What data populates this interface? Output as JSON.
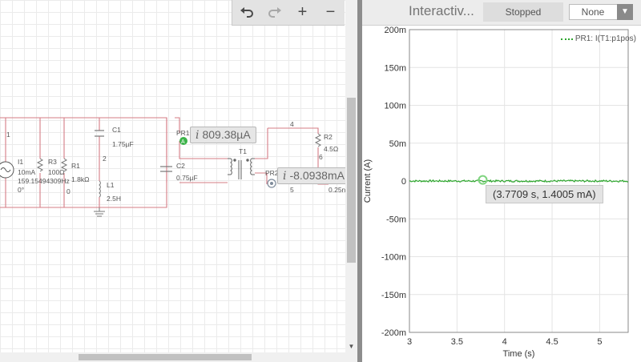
{
  "toolbar": {
    "undo_icon": "undo-icon",
    "redo_icon": "redo-icon",
    "zoom_in_label": "+",
    "zoom_out_label": "−"
  },
  "schematic": {
    "nodes": [
      "1",
      "2",
      "4",
      "5",
      "6",
      "0"
    ],
    "components": {
      "I1": {
        "name": "I1",
        "amp": "10mA",
        "freq": "159.15494309Hz",
        "phase": "0°"
      },
      "R3": {
        "name": "R3",
        "value": "100Ω"
      },
      "R1": {
        "name": "R1",
        "value": "1.8kΩ"
      },
      "C1": {
        "name": "C1",
        "value": "1.75µF"
      },
      "L1": {
        "name": "L1",
        "value": "2.5H"
      },
      "C2": {
        "name": "C2",
        "value": "0.75µF"
      },
      "T1": {
        "name": "T1"
      },
      "R2": {
        "name": "R2",
        "value": "4.5Ω"
      },
      "extra_value": "0.25n"
    },
    "probes": [
      {
        "name": "PR1",
        "symbol": "i",
        "value": "809.38µA",
        "color": "#3cb34a"
      },
      {
        "name": "PR2",
        "symbol": "i",
        "value": "-8.0938mA",
        "color": "#7f8c9b"
      }
    ],
    "wire_color": "#d47c86"
  },
  "grapher": {
    "title": "Interactiv...",
    "status": "Stopped",
    "trigger": "None",
    "legend": "PR1: I(T1:p1pos)",
    "trace_color": "#2ea62e",
    "cursor_readout": "(3.7709 s, 1.4005 mA)"
  },
  "chart_data": {
    "type": "line",
    "xlabel": "Time (s)",
    "ylabel": "Current (A)",
    "xlim": [
      3,
      5.3
    ],
    "ylim": [
      -0.2,
      0.2
    ],
    "x_ticks": [
      "3",
      "3.5",
      "4",
      "4.5",
      "5"
    ],
    "y_ticks": [
      "200m",
      "150m",
      "100m",
      "50m",
      "0",
      "-50m",
      "-100m",
      "-150m",
      "-200m"
    ],
    "grid": true,
    "series": [
      {
        "name": "PR1: I(T1:p1pos)",
        "x": [
          3.0,
          3.5,
          3.7709,
          4.0,
          4.5,
          5.0,
          5.3
        ],
        "y": [
          0.0,
          0.0,
          0.0014,
          0.0,
          0.0,
          0.0,
          0.0
        ]
      }
    ],
    "cursor": {
      "x": 3.7709,
      "y": 0.0014005
    }
  }
}
